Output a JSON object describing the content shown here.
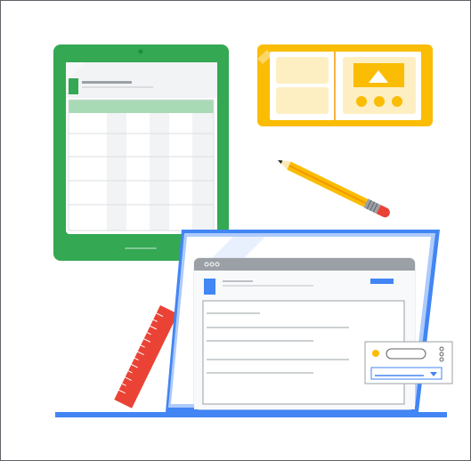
{
  "illustration": {
    "colors": {
      "border": "#5f6368",
      "green": "#34a853",
      "green_light": "#a8dab5",
      "yellow": "#fbbc04",
      "yellow_light": "#feefc3",
      "blue": "#4285f4",
      "blue_light": "#aecbfa",
      "red": "#ea4335",
      "grey_bar": "#9aa0a6",
      "grey_light": "#f1f3f4",
      "grey_line": "#dadce0"
    },
    "icons": [
      "tablet-spreadsheet-icon",
      "phone-photo-card-icon",
      "pencil-icon",
      "ruler-icon",
      "browser-window-icon",
      "settings-popup-icon"
    ]
  }
}
